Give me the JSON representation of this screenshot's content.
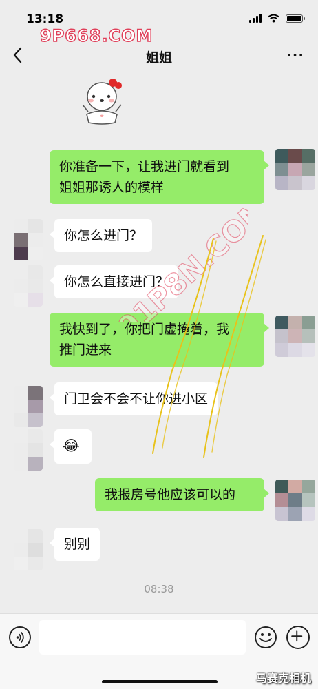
{
  "status_bar": {
    "time": "13:18",
    "battery_level": 1.0
  },
  "watermark": {
    "top_text": "9P668.COM",
    "diagonal_text": "91P8N.COM",
    "corner_text": "马赛克相机"
  },
  "nav": {
    "title": "姐姐",
    "more_label": "···",
    "back_icon": "chevron-left-icon"
  },
  "messages": [
    {
      "side": "me",
      "text_lines": [
        "你准备一下，让我进门就看到",
        "姐姐那诱人的模样"
      ]
    },
    {
      "side": "other",
      "text_lines": [
        "你怎么进门？"
      ]
    },
    {
      "side": "other",
      "text_lines": [
        "你怎么直接进门？"
      ]
    },
    {
      "side": "me",
      "text_lines": [
        "我快到了，你把门虚掩着，我",
        "推门进来"
      ]
    },
    {
      "side": "other",
      "text_lines": [
        "门卫会不会不让你进小区"
      ]
    },
    {
      "side": "other",
      "emoji": "😂"
    },
    {
      "side": "me",
      "text_lines": [
        "我报房号他应该可以的"
      ]
    },
    {
      "side": "other",
      "text_lines": [
        "别别"
      ]
    }
  ],
  "timestamp": "08:38",
  "input_bar": {
    "voice_icon": "voice-icon",
    "emoji_icon": "smiley-icon",
    "plus_icon": "plus-icon",
    "input_value": ""
  },
  "colors": {
    "background": "#ededed",
    "my_bubble": "#95ec69",
    "their_bubble": "#ffffff",
    "watermark": "#e0405a",
    "scribble": "#e8c21a"
  }
}
